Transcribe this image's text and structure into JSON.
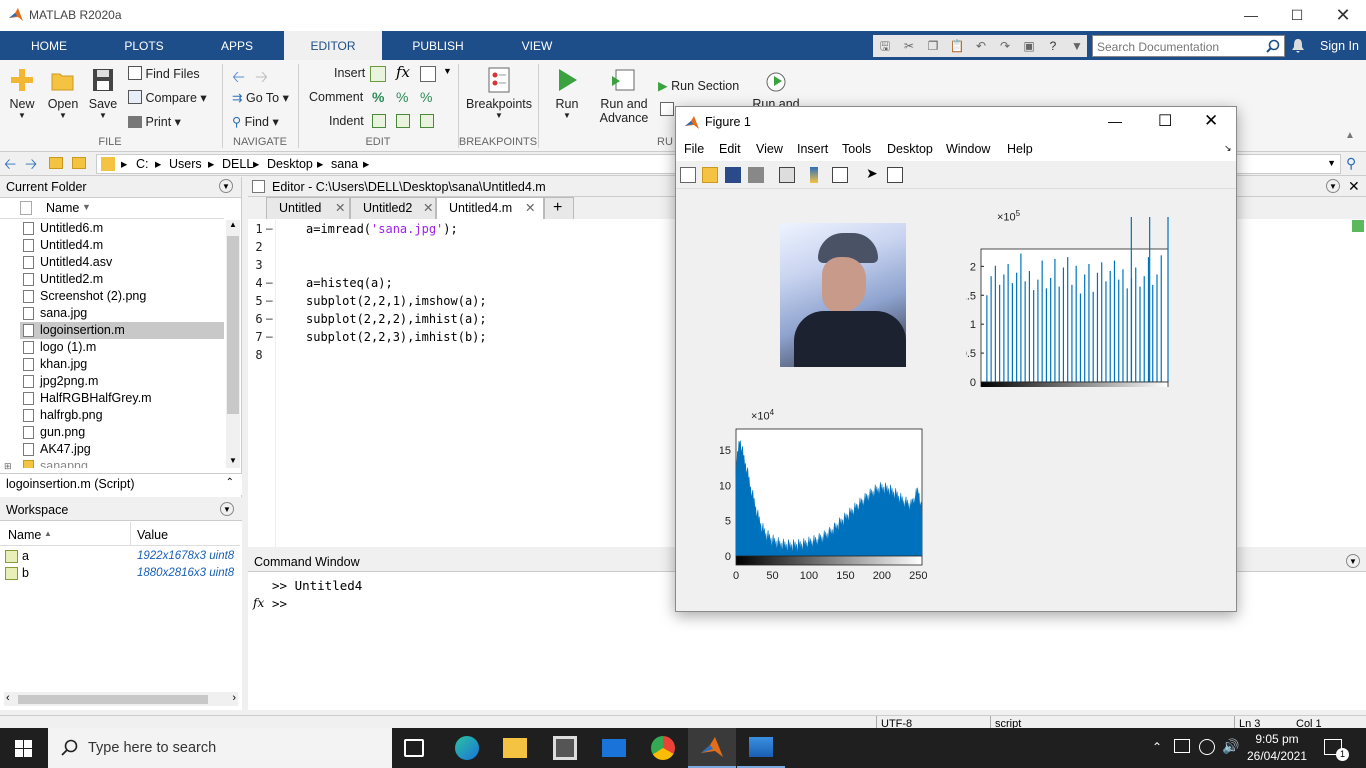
{
  "app": {
    "title": "MATLAB R2020a"
  },
  "tabs": [
    "HOME",
    "PLOTS",
    "APPS",
    "EDITOR",
    "PUBLISH",
    "VIEW"
  ],
  "search": {
    "placeholder": "Search Documentation",
    "signin": "Sign In"
  },
  "ribbon": {
    "file": {
      "new": "New",
      "open": "Open",
      "save": "Save",
      "find_files": "Find Files",
      "compare": "Compare",
      "print": "Print",
      "group": "FILE"
    },
    "navigate": {
      "go_to": "Go To",
      "find": "Find",
      "group": "NAVIGATE"
    },
    "edit": {
      "insert": "Insert",
      "comment": "Comment",
      "indent": "Indent",
      "group": "EDIT"
    },
    "breakpoints": {
      "label": "Breakpoints",
      "group": "BREAKPOINTS"
    },
    "run": {
      "run": "Run",
      "run_advance_1": "Run and",
      "run_advance_2": "Advance",
      "run_section": "Run Section",
      "run_and_time": "Run and",
      "group": "RU"
    }
  },
  "address": {
    "path": [
      "C:",
      "Users",
      "DELL",
      "Desktop",
      "sana"
    ]
  },
  "current_folder": {
    "title": "Current Folder",
    "col_name": "Name",
    "files": [
      "Untitled6.m",
      "Untitled4.m",
      "Untitled4.asv",
      "Untitled2.m",
      "Screenshot (2).png",
      "sana.jpg",
      "logoinsertion.m",
      "logo (1).m",
      "khan.jpg",
      "jpg2png.m",
      "HalfRGBHalfGrey.m",
      "halfrgb.png",
      "gun.png",
      "AK47.jpg",
      "sanapng"
    ],
    "selected": "logoinsertion.m",
    "details": "logoinsertion.m  (Script)"
  },
  "workspace": {
    "title": "Workspace",
    "col_name": "Name",
    "col_value": "Value",
    "vars": [
      {
        "name": "a",
        "value": "1922x1678x3 uint8"
      },
      {
        "name": "b",
        "value": "1880x2816x3 uint8"
      }
    ]
  },
  "editor": {
    "title": "Editor - C:\\Users\\DELL\\Desktop\\sana\\Untitled4.m",
    "tabs": [
      "Untitled",
      "Untitled2",
      "Untitled4.m"
    ],
    "line_numbers": [
      "1",
      "2",
      "3",
      "4",
      "5",
      "6",
      "7",
      "8"
    ],
    "code": {
      "l1a": "a=imread(",
      "l1s": "'sana.jpg'",
      "l1b": ");",
      "l4": "a=histeq(a);",
      "l5": "subplot(2,2,1),imshow(a);",
      "l6": "subplot(2,2,2),imhist(a);",
      "l7": "subplot(2,2,3),imhist(b);"
    }
  },
  "command_window": {
    "title": "Command Window",
    "line1": ">> Untitled4",
    "prompt": ">>",
    "fx": "fx"
  },
  "status": {
    "encoding": "UTF-8",
    "type": "script",
    "ln": "Ln  3",
    "col": "Col  1"
  },
  "figure": {
    "title": "Figure 1",
    "menu": [
      "File",
      "Edit",
      "View",
      "Insert",
      "Tools",
      "Desktop",
      "Window",
      "Help"
    ],
    "hist1": {
      "exp_base": "×10",
      "exp": "5",
      "yticks": [
        "2",
        "1.5",
        "1",
        "0.5",
        "0"
      ],
      "xticks": [
        "0",
        "50",
        "100",
        "150",
        "200",
        "250"
      ]
    },
    "hist2": {
      "exp_base": "×10",
      "exp": "4",
      "yticks": [
        "15",
        "10",
        "5",
        "0"
      ],
      "xticks": [
        "0",
        "50",
        "100",
        "150",
        "200",
        "250"
      ]
    }
  },
  "chart_data": [
    {
      "type": "bar",
      "xlim": [
        0,
        255
      ],
      "ylim": [
        0,
        230000
      ],
      "yticks": [
        0,
        50000,
        100000,
        150000,
        200000
      ],
      "note_values": "histogram-equalized: sparse spikes ~150000-230000"
    },
    {
      "type": "area",
      "xlim": [
        0,
        255
      ],
      "ylim": [
        0,
        180000
      ],
      "yticks": [
        0,
        50000,
        100000,
        150000
      ],
      "x": [
        0,
        5,
        10,
        15,
        20,
        25,
        30,
        35,
        40,
        50,
        60,
        70,
        80,
        90,
        100,
        110,
        120,
        130,
        140,
        150,
        160,
        170,
        180,
        190,
        200,
        210,
        220,
        230,
        240,
        250,
        255
      ],
      "y": [
        120000,
        165000,
        140000,
        120000,
        95000,
        75000,
        55000,
        40000,
        30000,
        20000,
        15000,
        13000,
        13000,
        14000,
        17000,
        20000,
        25000,
        32000,
        42000,
        52000,
        62000,
        72000,
        82000,
        90000,
        95000,
        92000,
        85000,
        75000,
        70000,
        92000,
        60000
      ]
    }
  ],
  "taskbar": {
    "search_placeholder": "Type here to search",
    "time": "9:05 pm",
    "date": "26/04/2021",
    "notif": "1"
  }
}
